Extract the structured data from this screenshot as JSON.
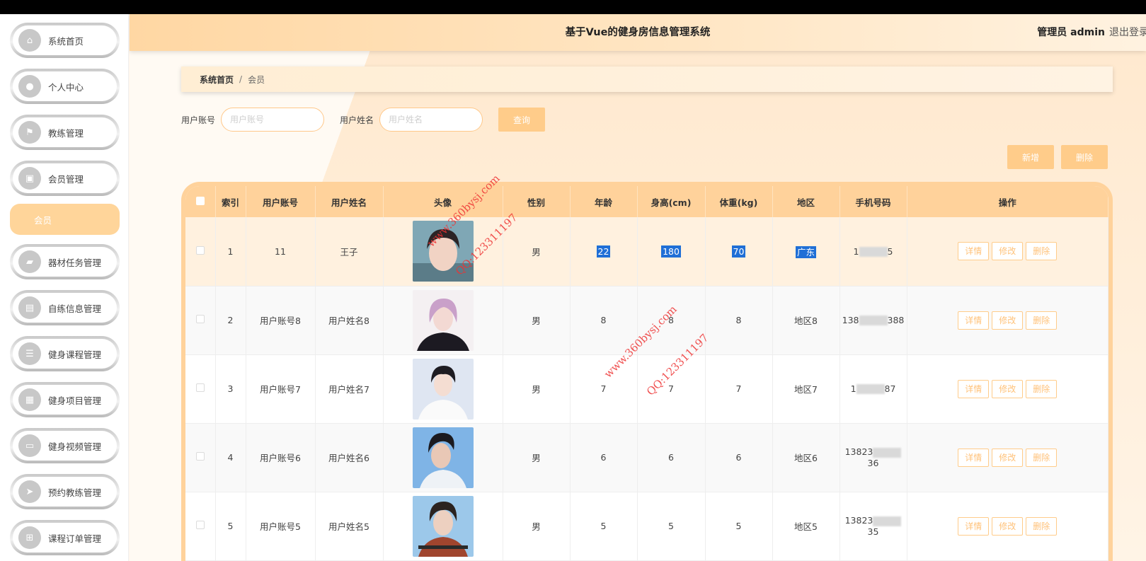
{
  "header": {
    "title": "基于Vue的健身房信息管理系统",
    "user": "管理员 admin",
    "logout": "退出登录"
  },
  "sidebar": {
    "items": [
      {
        "label": "系统首页",
        "icon": "home-icon"
      },
      {
        "label": "个人中心",
        "icon": "user-icon"
      },
      {
        "label": "教练管理",
        "icon": "flag-icon"
      },
      {
        "label": "会员管理",
        "icon": "briefcase-icon"
      },
      {
        "label": "器材任务管理",
        "icon": "ticket-icon"
      },
      {
        "label": "自练信息管理",
        "icon": "chat-icon"
      },
      {
        "label": "健身课程管理",
        "icon": "list-icon"
      },
      {
        "label": "健身项目管理",
        "icon": "grid-icon"
      },
      {
        "label": "健身视频管理",
        "icon": "monitor-icon"
      },
      {
        "label": "预约教练管理",
        "icon": "send-icon"
      },
      {
        "label": "课程订单管理",
        "icon": "apps-icon"
      }
    ],
    "active_sub": "会员"
  },
  "breadcrumb": {
    "home": "系统首页",
    "sep": "/",
    "current": "会员"
  },
  "search": {
    "account_label": "用户账号",
    "account_placeholder": "用户账号",
    "name_label": "用户姓名",
    "name_placeholder": "用户姓名",
    "query_button": "查询"
  },
  "actions": {
    "add": "新增",
    "delete": "删除"
  },
  "table": {
    "headers": [
      "索引",
      "用户账号",
      "用户姓名",
      "头像",
      "性别",
      "年龄",
      "身高(cm)",
      "体重(kg)",
      "地区",
      "手机号码",
      "操作"
    ],
    "rows": [
      {
        "index": "1",
        "account": "11",
        "name": "王子",
        "gender": "男",
        "age": "22",
        "height": "180",
        "weight": "70",
        "region": "广东",
        "phone_a": "1",
        "phone_b": "5"
      },
      {
        "index": "2",
        "account": "用户账号8",
        "name": "用户姓名8",
        "gender": "男",
        "age": "8",
        "height": "8",
        "weight": "8",
        "region": "地区8",
        "phone_a": "138",
        "phone_b": "388"
      },
      {
        "index": "3",
        "account": "用户账号7",
        "name": "用户姓名7",
        "gender": "男",
        "age": "7",
        "height": "7",
        "weight": "7",
        "region": "地区7",
        "phone_a": "1",
        "phone_b": "87"
      },
      {
        "index": "4",
        "account": "用户账号6",
        "name": "用户姓名6",
        "gender": "男",
        "age": "6",
        "height": "6",
        "weight": "6",
        "region": "地区6",
        "phone_a": "13823",
        "phone_b": "36"
      },
      {
        "index": "5",
        "account": "用户账号5",
        "name": "用户姓名5",
        "gender": "男",
        "age": "5",
        "height": "5",
        "weight": "5",
        "region": "地区5",
        "phone_a": "13823",
        "phone_b": "35"
      }
    ],
    "row_actions": {
      "detail": "详情",
      "edit": "修改",
      "delete": "删除"
    }
  },
  "watermarks": [
    {
      "url": "www.360bysj.com",
      "qq": "QQ:123311197"
    },
    {
      "url": "www.360bysj.com",
      "qq": "QQ:123311197"
    }
  ],
  "colors": {
    "accent": "#ffcc8a",
    "header_bg": "#ffd7a3",
    "table_head": "#ffd29b",
    "selection": "#1f6fd6"
  }
}
